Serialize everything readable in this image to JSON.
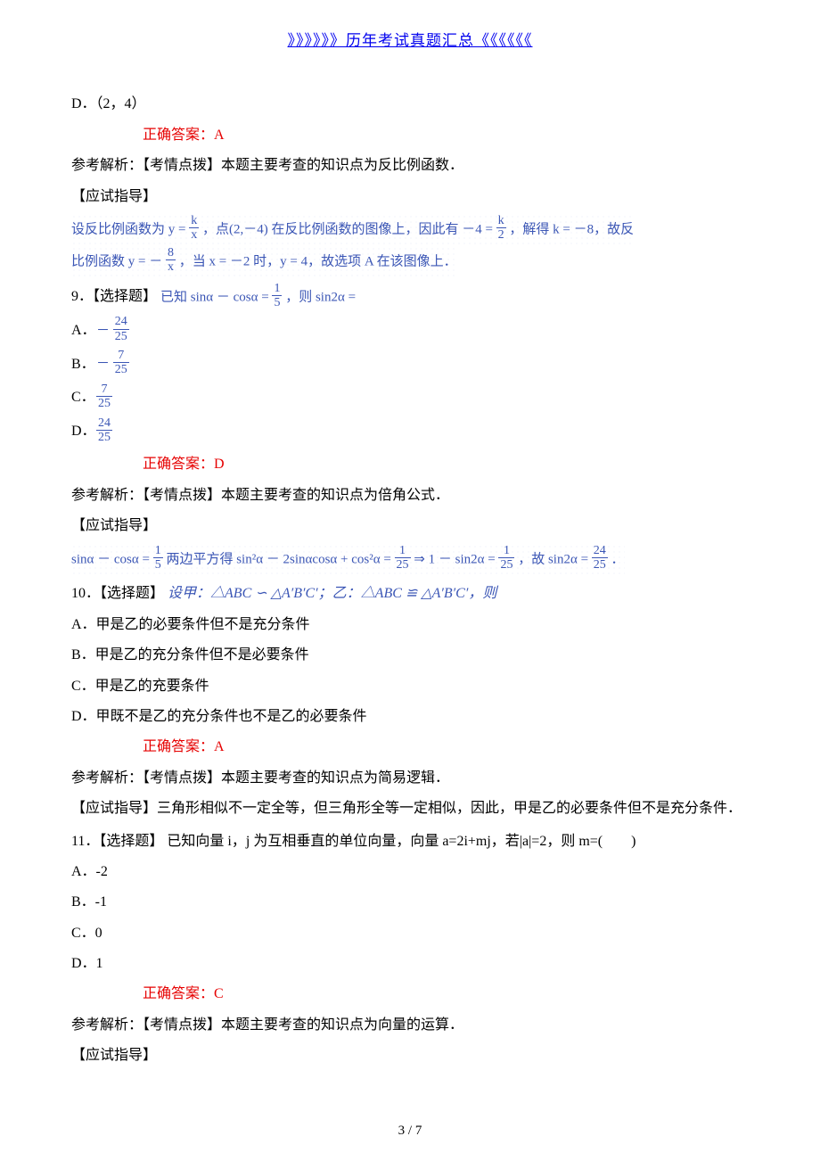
{
  "header": {
    "banner_text": "》》》》》》历年考试真题汇总《《《《《《"
  },
  "q_pre": {
    "opt_d": "D．（2，4）",
    "answer": "正确答案：A",
    "analysis": "参考解析：【考情点拨】本题主要考查的知识点为反比例函数．",
    "guide_label": "【应试指导】",
    "guide_line1_pre": "设反比例函数为 y = ",
    "guide_line1_mid": "，点(2,－4) 在反比例函数的图像上，因此有 －4 = ",
    "guide_line1_post": "，解得 k = －8，故反",
    "guide_line2_pre": "比例函数 y = －",
    "guide_line2_mid": "，当 x = －2 时，y = 4，故选项 A 在该图像上．",
    "frac1_num": "k",
    "frac1_den": "x",
    "frac2_num": "k",
    "frac2_den": "2",
    "frac3_num": "8",
    "frac3_den": "x"
  },
  "q9": {
    "label": "9．【选择题】",
    "stem_pre": "已知 sinα － cosα = ",
    "stem_post": "，则 sin2α =",
    "stem_frac_num": "1",
    "stem_frac_den": "5",
    "a_label": "A．",
    "a_sign": "－",
    "a_num": "24",
    "a_den": "25",
    "b_label": "B．",
    "b_sign": "－",
    "b_num": "7",
    "b_den": "25",
    "c_label": "C．",
    "c_num": "7",
    "c_den": "25",
    "d_label": "D．",
    "d_num": "24",
    "d_den": "25",
    "answer": "正确答案：D",
    "analysis": "参考解析：【考情点拨】本题主要考查的知识点为倍角公式．",
    "guide_label": "【应试指导】",
    "guide_pre": "sinα － cosα = ",
    "guide_f1n": "1",
    "guide_f1d": "5",
    "guide_mid1": " 两边平方得 sin²α － 2sinαcosα + cos²α = ",
    "guide_f2n": "1",
    "guide_f2d": "25",
    "guide_mid2": " ⇒ 1 － sin2α = ",
    "guide_f3n": "1",
    "guide_f3d": "25",
    "guide_mid3": "，故 sin2α = ",
    "guide_f4n": "24",
    "guide_f4d": "25",
    "guide_post": "．"
  },
  "q10": {
    "label": "10．【选择题】",
    "stem": "设甲：△ABC ∽ △A′B′C′；乙：△ABC ≌ △A′B′C′，则",
    "a": "A．甲是乙的必要条件但不是充分条件",
    "b": "B．甲是乙的充分条件但不是必要条件",
    "c": "C．甲是乙的充要条件",
    "d": "D．甲既不是乙的充分条件也不是乙的必要条件",
    "answer": "正确答案：A",
    "analysis": "参考解析：【考情点拨】本题主要考查的知识点为简易逻辑．",
    "guide": "【应试指导】三角形相似不一定全等，但三角形全等一定相似，因此，甲是乙的必要条件但不是充分条件．"
  },
  "q11": {
    "label": "11．【选择题】",
    "stem": "已知向量 i，j 为互相垂直的单位向量，向量 a=2i+mj，若|a|=2，则 m=(　　)",
    "a": "A．-2",
    "b": "B．-1",
    "c": "C．0",
    "d": "D．1",
    "answer": "正确答案：C",
    "analysis": "参考解析：【考情点拨】本题主要考查的知识点为向量的运算．",
    "guide_label": "【应试指导】"
  },
  "footer": {
    "page": "3 / 7"
  }
}
